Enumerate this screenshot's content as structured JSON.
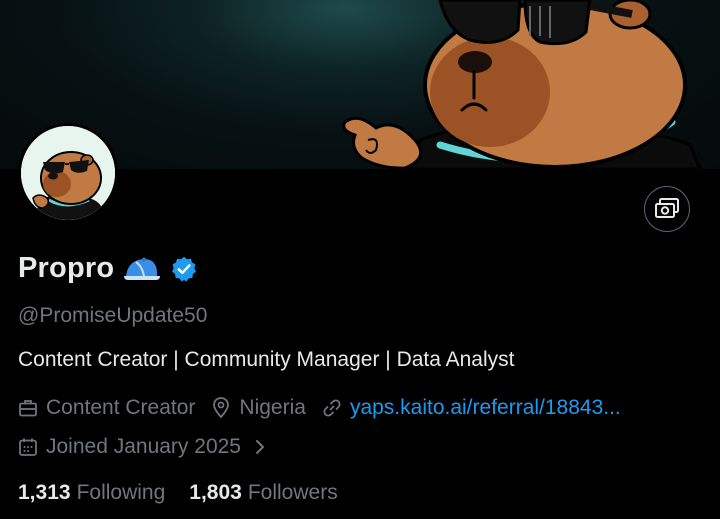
{
  "profile": {
    "name": "Propro",
    "handle": "@PromiseUpdate50",
    "bio": "Content Creator | Community Manager | Data Analyst",
    "category": "Content Creator",
    "location": "Nigeria",
    "website": "yaps.kaito.ai/referral/18843...",
    "joined": "Joined January 2025"
  },
  "stats": {
    "following_count": "1,313",
    "following_label": "Following",
    "followers_count": "1,803",
    "followers_label": "Followers"
  },
  "colors": {
    "background": "#000000",
    "text_primary": "#e7e9ea",
    "text_secondary": "#71767b",
    "link": "#1d9bf0",
    "verified": "#1d9bf0"
  },
  "icons": {
    "action_button": "money-icon",
    "category": "briefcase-icon",
    "location": "location-pin-icon",
    "website": "link-icon",
    "joined": "calendar-icon",
    "joined_more": "chevron-right-icon",
    "name_emoji": "cap-icon",
    "badge": "verified-badge-icon"
  }
}
